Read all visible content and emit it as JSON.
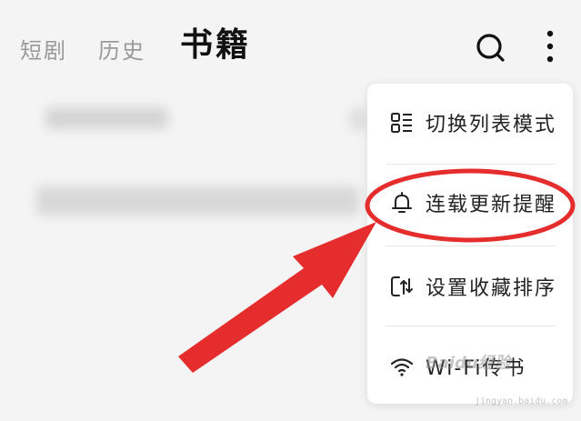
{
  "tabs": [
    {
      "label": "短剧"
    },
    {
      "label": "历史"
    },
    {
      "label": "书籍",
      "active": true
    }
  ],
  "icons": {
    "search": "search-icon",
    "more": "more-vertical-icon"
  },
  "menu": {
    "items": [
      {
        "label": "切换列表模式",
        "icon": "list-grid-icon"
      },
      {
        "label": "连载更新提醒",
        "icon": "bell-icon",
        "highlighted": true
      },
      {
        "label": "设置收藏排序",
        "icon": "sort-icon"
      },
      {
        "label": "Wi-Fi传书",
        "icon": "wifi-icon"
      }
    ]
  },
  "annotation": {
    "color": "#e52d2d"
  },
  "watermark": {
    "brand": "Baidu经验",
    "site": "jingyan.baidu.com"
  }
}
